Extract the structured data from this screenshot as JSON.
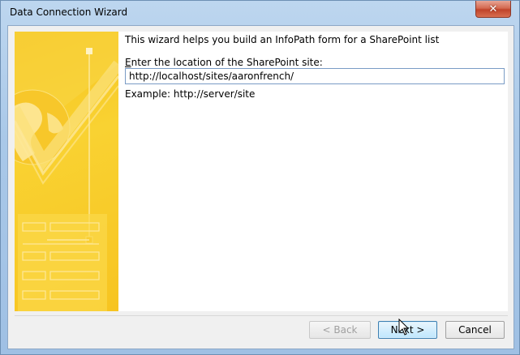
{
  "window": {
    "title": "Data Connection Wizard",
    "close_glyph": "✕"
  },
  "wizard": {
    "intro_text": "This wizard helps you build an InfoPath form for a SharePoint list",
    "location_label_accel": "E",
    "location_label_rest": "nter the location of the SharePoint site:",
    "site_url_value": "http://localhost/sites/aaronfrench/",
    "example_text": "Example: http://server/site"
  },
  "buttons": {
    "back_label": "< Back",
    "next_label": "Next >",
    "cancel_label": "Cancel"
  },
  "colors": {
    "art_yellow": "#f7c420",
    "art_light": "#fbe27a",
    "accent_blue": "#3c7fb1"
  },
  "icons": {
    "art_graphic": "infopath-wizard-banner",
    "cursor": "mouse-pointer-icon"
  }
}
